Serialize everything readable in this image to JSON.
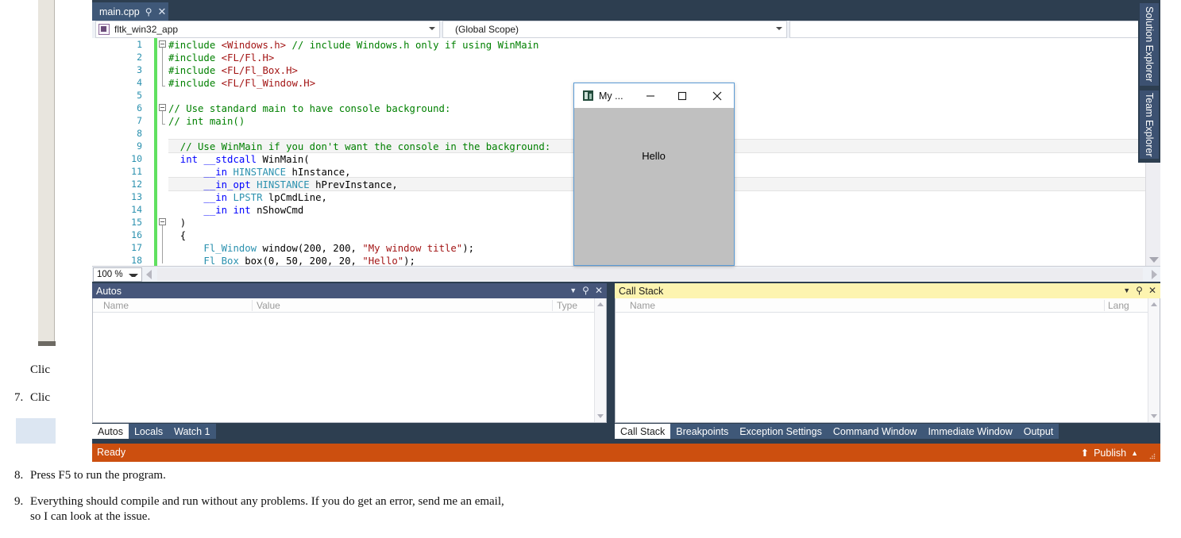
{
  "document": {
    "clipped_line_a": "Clic",
    "clipped_line_b": "Clic",
    "item7_num": "7.",
    "item8_num": "8.",
    "item8_text": "Press F5 to run the program.",
    "item9_num": "9.",
    "item9_line1": "Everything should compile and run without any problems. If you do get an error, send me an email,",
    "item9_line2": "so I can look at the issue."
  },
  "vs": {
    "editor_tab": {
      "label": "main.cpp",
      "pin_icon": "pin-icon",
      "close_icon": "close-icon"
    },
    "tabrow_overflow_icon": "chevron-down-icon",
    "navbar": {
      "project_value": "fltk_win32_app",
      "project_icon": "project-icon",
      "scope_value": "(Global Scope)",
      "dropdown_icon": "chevron-down-icon"
    },
    "zoom_level": "100 %",
    "line_numbers": [
      "1",
      "2",
      "3",
      "4",
      "5",
      "6",
      "7",
      "8",
      "9",
      "10",
      "11",
      "12",
      "13",
      "14",
      "15",
      "16",
      "17",
      "18"
    ],
    "code_lines": [
      {
        "n": 1,
        "segments": [
          {
            "t": "#include ",
            "c": "cm"
          },
          {
            "t": "<Windows.h>",
            "c": "st"
          },
          {
            "t": " // include Windows.h only if using WinMain",
            "c": "cm"
          }
        ]
      },
      {
        "n": 2,
        "segments": [
          {
            "t": "#include ",
            "c": "cm"
          },
          {
            "t": "<FL/Fl.H>",
            "c": "st"
          }
        ]
      },
      {
        "n": 3,
        "segments": [
          {
            "t": "#include ",
            "c": "cm"
          },
          {
            "t": "<FL/Fl_Box.H>",
            "c": "st"
          }
        ]
      },
      {
        "n": 4,
        "segments": [
          {
            "t": "#include ",
            "c": "cm"
          },
          {
            "t": "<FL/Fl_Window.H>",
            "c": "st"
          }
        ]
      },
      {
        "n": 5,
        "segments": []
      },
      {
        "n": 6,
        "segments": [
          {
            "t": "// Use standard main to have console background:",
            "c": "cm"
          }
        ]
      },
      {
        "n": 7,
        "segments": [
          {
            "t": "// int main()",
            "c": "cm"
          }
        ]
      },
      {
        "n": 8,
        "segments": []
      },
      {
        "n": 9,
        "segments": [
          {
            "t": "  // Use WinMain if you don't want the console in the background:",
            "c": "cm"
          }
        ]
      },
      {
        "n": 10,
        "segments": [
          {
            "t": "  int",
            "c": "k"
          },
          {
            "t": " ",
            "c": "tx"
          },
          {
            "t": "__stdcall",
            "c": "k"
          },
          {
            "t": " WinMain(",
            "c": "tx"
          }
        ]
      },
      {
        "n": 11,
        "segments": [
          {
            "t": "      ",
            "c": "tx"
          },
          {
            "t": "__in",
            "c": "k"
          },
          {
            "t": " ",
            "c": "tx"
          },
          {
            "t": "HINSTANCE",
            "c": "mc"
          },
          {
            "t": " hInstance,",
            "c": "tx"
          }
        ]
      },
      {
        "n": 12,
        "segments": [
          {
            "t": "      ",
            "c": "tx"
          },
          {
            "t": "__in_opt",
            "c": "k"
          },
          {
            "t": " ",
            "c": "tx"
          },
          {
            "t": "HINSTANCE",
            "c": "mc"
          },
          {
            "t": " hPrevInstance,",
            "c": "tx"
          }
        ]
      },
      {
        "n": 13,
        "segments": [
          {
            "t": "      ",
            "c": "tx"
          },
          {
            "t": "__in",
            "c": "k"
          },
          {
            "t": " ",
            "c": "tx"
          },
          {
            "t": "LPSTR",
            "c": "mc"
          },
          {
            "t": " lpCmdLine,",
            "c": "tx"
          }
        ]
      },
      {
        "n": 14,
        "segments": [
          {
            "t": "      ",
            "c": "tx"
          },
          {
            "t": "__in",
            "c": "k"
          },
          {
            "t": " ",
            "c": "tx"
          },
          {
            "t": "int",
            "c": "k"
          },
          {
            "t": " nShowCmd",
            "c": "tx"
          }
        ]
      },
      {
        "n": 15,
        "segments": [
          {
            "t": "  )",
            "c": "tx"
          }
        ]
      },
      {
        "n": 16,
        "segments": [
          {
            "t": "  {",
            "c": "tx"
          }
        ]
      },
      {
        "n": 17,
        "segments": [
          {
            "t": "      ",
            "c": "tx"
          },
          {
            "t": "Fl_Window",
            "c": "ty"
          },
          {
            "t": " window(200, 200, ",
            "c": "tx"
          },
          {
            "t": "\"My window title\"",
            "c": "st"
          },
          {
            "t": ");",
            "c": "tx"
          }
        ]
      },
      {
        "n": 18,
        "segments": [
          {
            "t": "      ",
            "c": "tx"
          },
          {
            "t": "Fl_Box",
            "c": "ty"
          },
          {
            "t": " box(0, 50, 200, 20, ",
            "c": "tx"
          },
          {
            "t": "\"Hello\"",
            "c": "st"
          },
          {
            "t": ");",
            "c": "tx"
          }
        ]
      }
    ],
    "autos_panel": {
      "title": "Autos",
      "dropdown_icon": "chevron-down-icon",
      "pin_icon": "pin-icon",
      "close_icon": "close-icon",
      "columns": [
        "Name",
        "Value",
        "Type"
      ],
      "rows": []
    },
    "callstack_panel": {
      "title": "Call Stack",
      "dropdown_icon": "chevron-down-icon",
      "pin_icon": "pin-icon",
      "close_icon": "close-icon",
      "columns": [
        "Name",
        "Lang"
      ],
      "rows": []
    },
    "left_dock_tabs": [
      {
        "label": "Autos",
        "selected": true
      },
      {
        "label": "Locals",
        "selected": false
      },
      {
        "label": "Watch 1",
        "selected": false
      }
    ],
    "right_dock_tabs": [
      {
        "label": "Call Stack",
        "selected": true
      },
      {
        "label": "Breakpoints",
        "selected": false
      },
      {
        "label": "Exception Settings",
        "selected": false
      },
      {
        "label": "Command Window",
        "selected": false
      },
      {
        "label": "Immediate Window",
        "selected": false
      },
      {
        "label": "Output",
        "selected": false
      }
    ],
    "statusbar": {
      "status_text": "Ready",
      "publish_label": "Publish",
      "publish_up_icon": "arrow-up-icon",
      "publish_caret_icon": "caret-up-icon",
      "resize_grip_icon": "resize-grip-icon"
    },
    "vertical_tabs": [
      {
        "label": "Solution Explorer"
      },
      {
        "label": "Team Explorer"
      }
    ],
    "colors": {
      "chrome": "#2d3e50",
      "tab_inactive": "#3f5878",
      "status_debug_orange": "#cc4f0f",
      "callstack_active_yellow": "#fdf4b0",
      "autos_title_bar": "#46567a",
      "change_bar_green": "#60e060"
    }
  },
  "fltk_window": {
    "app_icon": "app-icon",
    "title": "My ...",
    "minimize_icon": "minimize-icon",
    "maximize_icon": "maximize-icon",
    "close_icon": "close-icon",
    "box_label": "Hello",
    "client_bg": "#c0c0c0"
  }
}
